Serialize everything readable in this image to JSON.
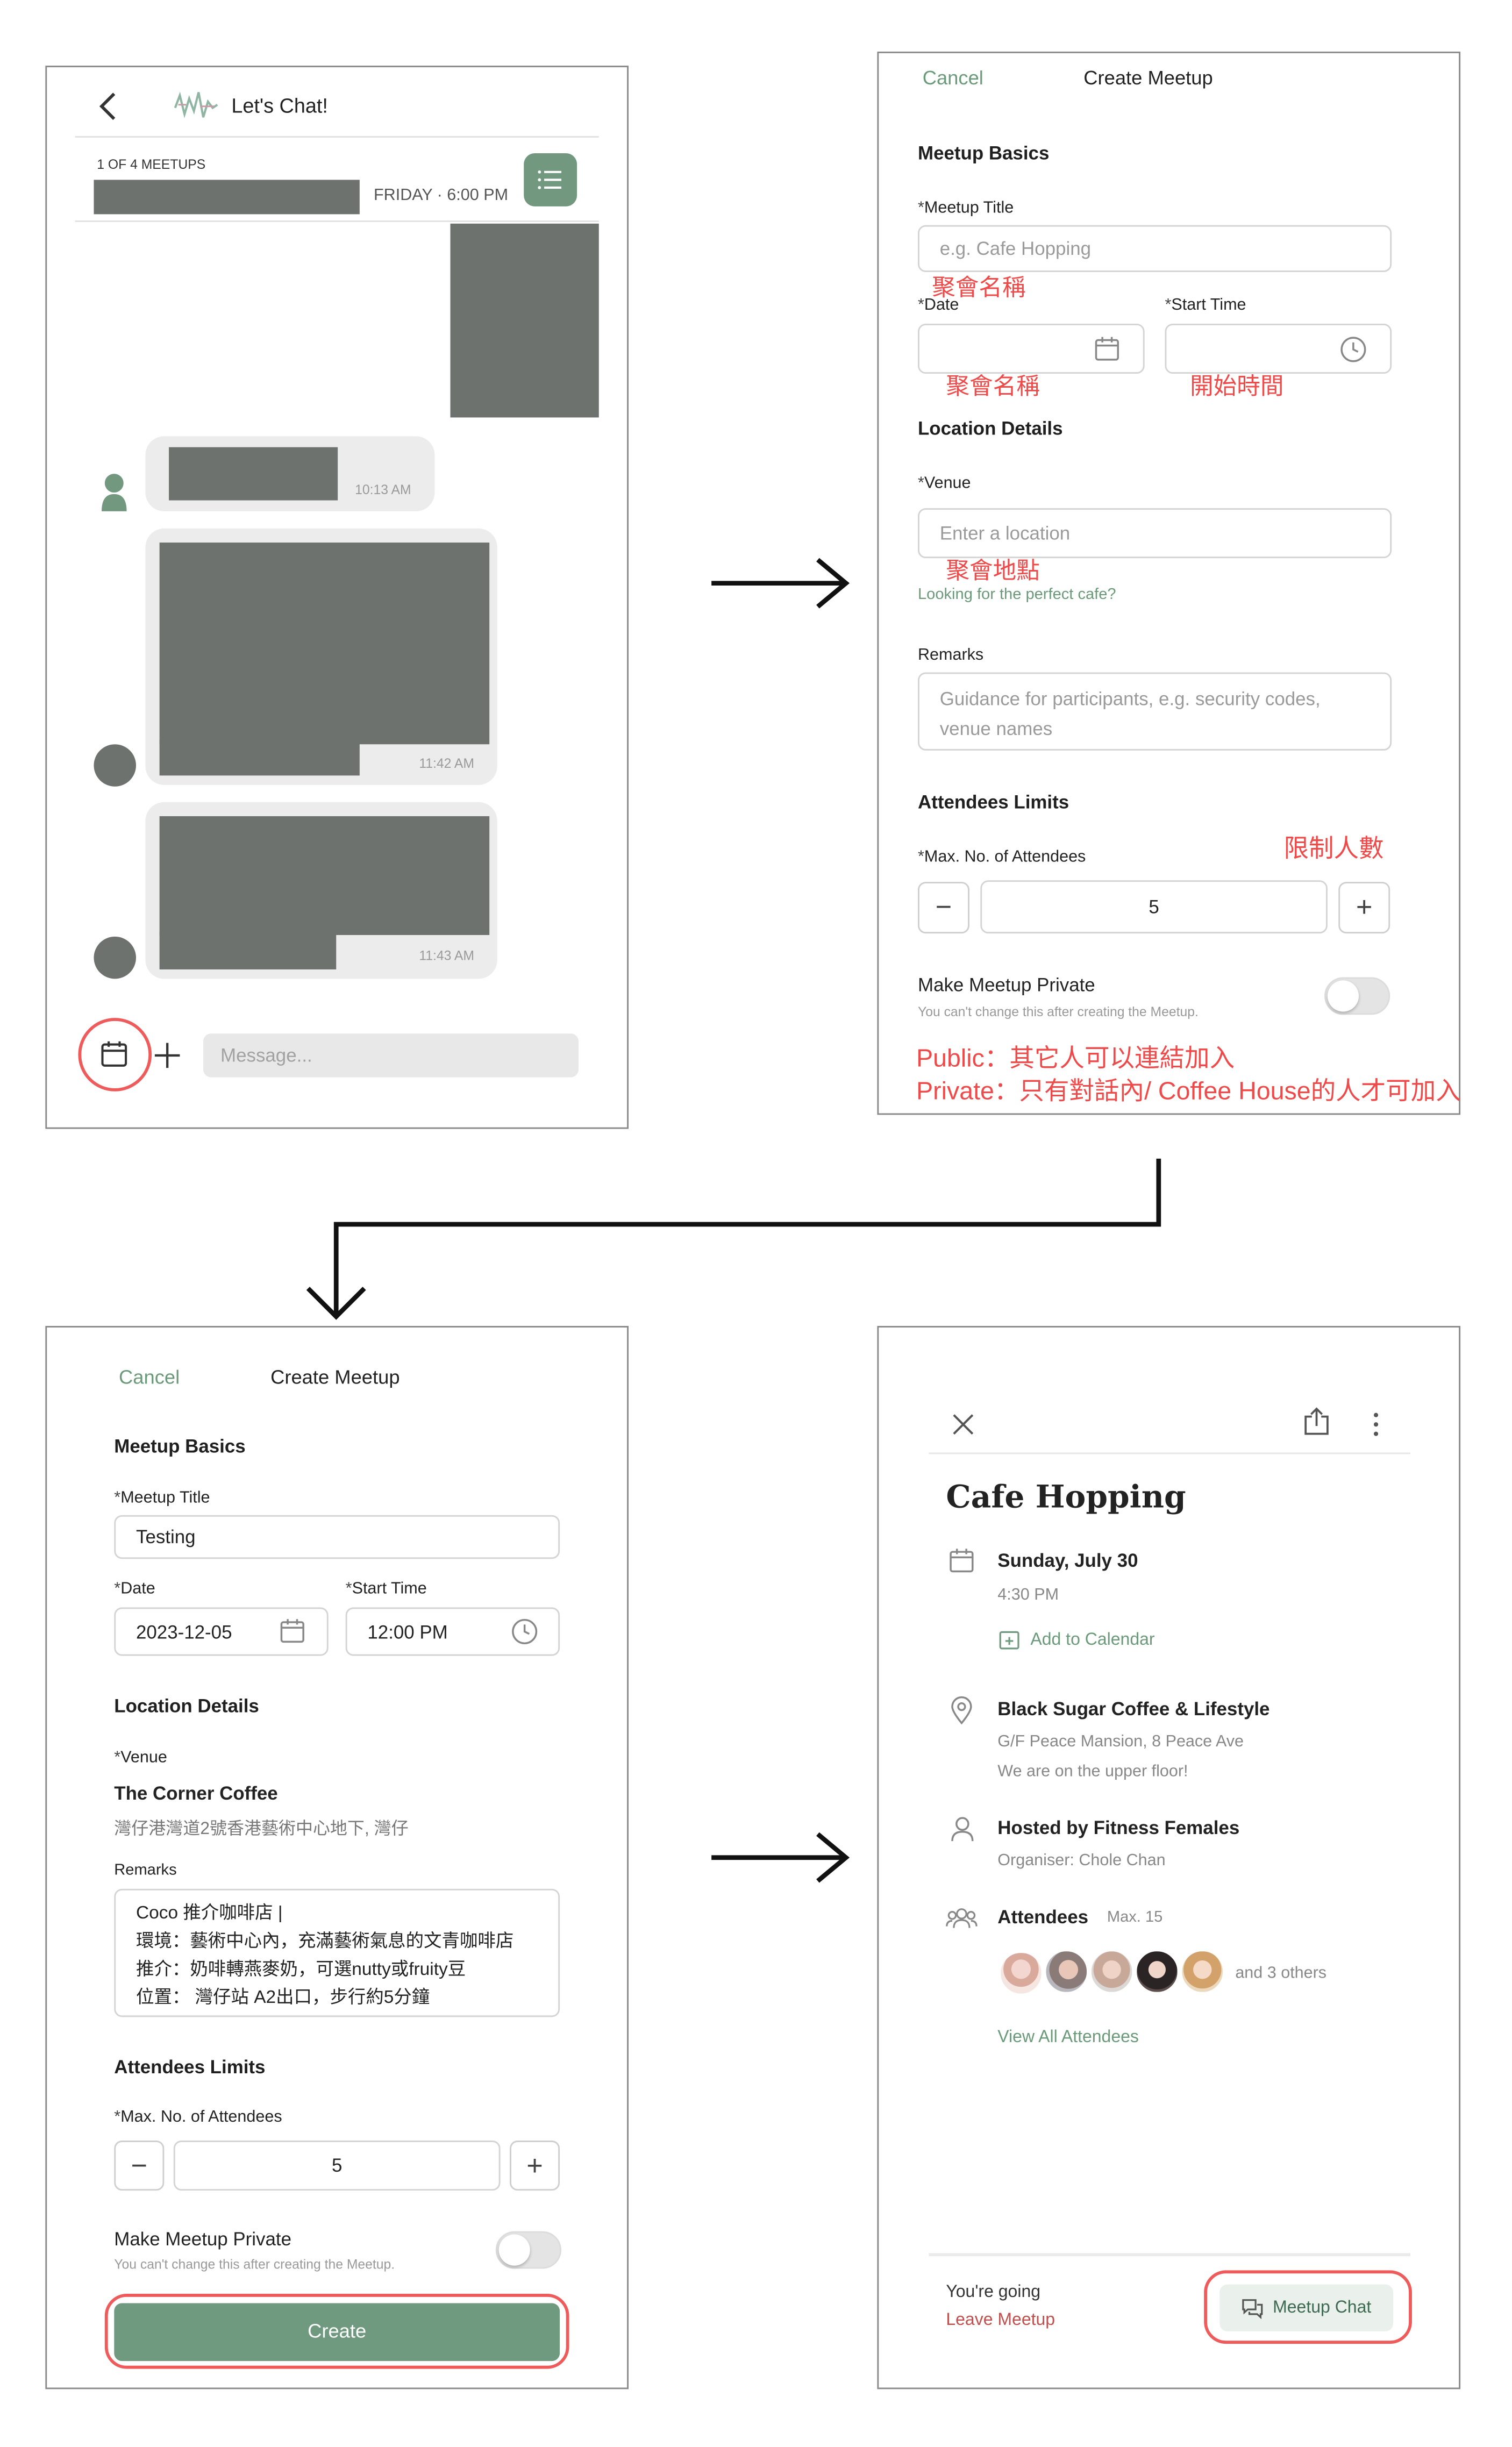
{
  "chat": {
    "title": "Let's Chat!",
    "meetups_count": "1 OF 4 MEETUPS",
    "meetup_time": "FRIDAY · 6:00 PM",
    "msg_times": [
      "10:13 AM",
      "11:42 AM",
      "11:43 AM"
    ],
    "message_placeholder": "Message..."
  },
  "create_form_empty": {
    "cancel": "Cancel",
    "title": "Create Meetup",
    "meetup_basics": "Meetup Basics",
    "meetup_title_label": "Meetup Title",
    "meetup_title_placeholder": "e.g. Cafe Hopping",
    "date_label": "Date",
    "start_time_label": "Start Time",
    "location_details": "Location Details",
    "venue_label": "Venue",
    "venue_placeholder": "Enter a location",
    "venue_help_link": "Looking for the perfect cafe?",
    "remarks_label": "Remarks",
    "remarks_placeholder_1": "Guidance for participants, e.g. security codes,",
    "remarks_placeholder_2": "venue names",
    "attendees_limits": "Attendees Limits",
    "max_attendees_label": "Max. No. of Attendees",
    "max_attendees_value": "5",
    "private_label": "Make Meetup Private",
    "private_note": "You can't change this after creating the Meetup."
  },
  "annotations": {
    "title_zh": "聚會名稱",
    "date_zh": "聚會名稱",
    "time_zh": "開始時間",
    "venue_zh": "聚會地點",
    "limit_zh": "限制人數",
    "public_note": "Public：其它人可以連結加入",
    "private_note": "Private：只有對話內/ Coffee House的人才可加入"
  },
  "create_form_filled": {
    "cancel": "Cancel",
    "title": "Create Meetup",
    "meetup_basics": "Meetup Basics",
    "meetup_title_label": "Meetup Title",
    "meetup_title_value": "Testing",
    "date_label": "Date",
    "date_value": "2023-12-05",
    "start_time_label": "Start Time",
    "start_time_value": "12:00 PM",
    "location_details": "Location Details",
    "venue_label": "Venue",
    "venue_name": "The Corner Coffee",
    "venue_address": "灣仔港灣道2號香港藝術中心地下, 灣仔",
    "remarks_label": "Remarks",
    "remarks_lines": [
      "Coco 推介咖啡店 |",
      "環境：藝術中心內，充滿藝術氣息的文青咖啡店",
      "推介：奶啡轉燕麥奶，可選nutty或fruity豆",
      "位置： 灣仔站 A2出口，步行約5分鐘"
    ],
    "attendees_limits": "Attendees Limits",
    "max_attendees_label": "Max. No. of Attendees",
    "max_attendees_value": "5",
    "private_label": "Make Meetup Private",
    "private_note": "You can't change this after creating the Meetup.",
    "create_button": "Create"
  },
  "meetup_detail": {
    "title": "Cafe Hopping",
    "date": "Sunday, July 30",
    "time": "4:30 PM",
    "add_to_calendar": "Add to Calendar",
    "venue_name": "Black Sugar Coffee & Lifestyle",
    "venue_address": "G/F Peace Mansion, 8 Peace Ave",
    "venue_note": "We are on the upper floor!",
    "host": "Hosted by Fitness Females",
    "organiser": "Organiser: Chole Chan",
    "attendees_label": "Attendees",
    "attendees_max": "Max. 15",
    "others": "and 3 others",
    "view_all": "View All Attendees",
    "going": "You're going",
    "leave": "Leave Meetup",
    "meetup_chat": "Meetup Chat"
  },
  "colors": {
    "accent_green": "#6f9a80",
    "annotation_red": "#ef4a4a",
    "redacted_gray": "#6e726f",
    "leave_red": "#c0504d"
  }
}
